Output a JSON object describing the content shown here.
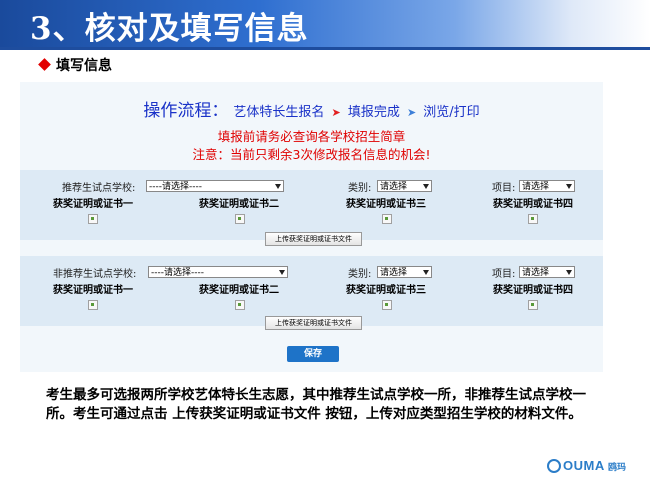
{
  "slide": {
    "title": "3、核对及填写信息",
    "subhead": "填写信息"
  },
  "flow": {
    "label": "操作流程：",
    "steps": [
      "艺体特长生报名",
      "填报完成",
      "浏览/打印"
    ]
  },
  "notices": {
    "line1": "填报前请务必查询各学校招生简章",
    "line2": "注意：当前只剩余3次修改报名信息的机会!"
  },
  "section1": {
    "school_label": "推荐生试点学校:",
    "school_value": "----请选择----",
    "category_label": "类别:",
    "category_value": "请选择",
    "item_label": "项目:",
    "item_value": "请选择",
    "certs": [
      "获奖证明或证书一",
      "获奖证明或证书二",
      "获奖证明或证书三",
      "获奖证明或证书四"
    ],
    "upload_label": "上传获奖证明或证书文件"
  },
  "section2": {
    "school_label": "非推荐生试点学校:",
    "school_value": "----请选择----",
    "category_label": "类别:",
    "category_value": "请选择",
    "item_label": "项目:",
    "item_value": "请选择",
    "certs": [
      "获奖证明或证书一",
      "获奖证明或证书二",
      "获奖证明或证书三",
      "获奖证明或证书四"
    ],
    "upload_label": "上传获奖证明或证书文件"
  },
  "save_label": "保存",
  "description": "考生最多可选报两所学校艺体特长生志愿，其中推荐生试点学校一所，非推荐生试点学校一所。考生可通过点击 上传获奖证明或证书文件 按钮，上传对应类型招生学校的材料文件。",
  "logo": {
    "brand": "OUMA",
    "cn": "鸥玛"
  },
  "colors": {
    "title_band": "#2f6fd0",
    "flow_text": "#1a32c8",
    "notice": "#e00000",
    "save_button": "#1e73c8"
  }
}
